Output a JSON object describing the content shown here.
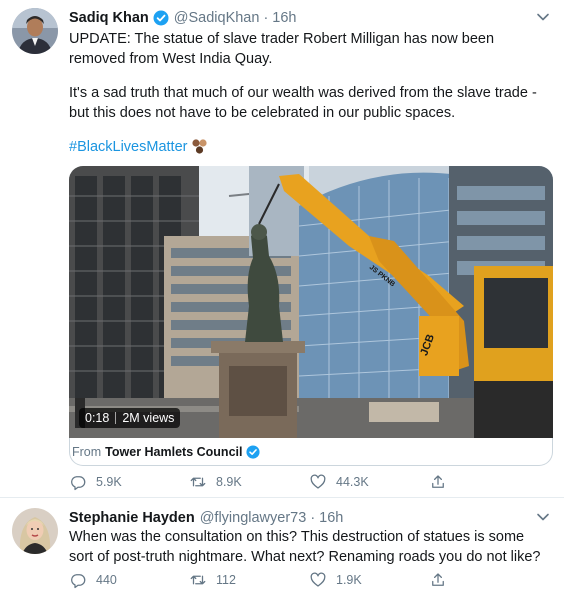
{
  "tweets": [
    {
      "author_name": "Sadiq Khan",
      "handle": "@SadiqKhan",
      "separator": "·",
      "time": "16h",
      "text_line_1": "UPDATE: The statue of slave trader Robert Milligan has now been removed from West India Quay.",
      "text_line_2": "It's a sad truth that much of our wealth was derived from the slave trade - but this does not have to be celebrated in our public spaces.",
      "hashtag": "#BlackLivesMatter",
      "media": {
        "duration": "0:18",
        "views": "2M views",
        "machine_label": "JCB",
        "machine_label_2": "JS PKNB"
      },
      "source_prefix": "From",
      "source_name": "Tower Hamlets Council",
      "replies": "5.9K",
      "retweets": "8.9K",
      "likes": "44.3K"
    },
    {
      "author_name": "Stephanie Hayden",
      "handle": "@flyinglawyer73",
      "separator": "·",
      "time": "16h",
      "text": "When was the consultation on this? This destruction of statues is some sort of post-truth nightmare. What next? Renaming roads you do not like?",
      "replies": "440",
      "retweets": "112",
      "likes": "1.9K"
    }
  ],
  "icons": {
    "verified": "verified-badge-icon",
    "caret": "chevron-down-icon",
    "reply": "reply-icon",
    "retweet": "retweet-icon",
    "like": "heart-icon",
    "share": "share-icon"
  },
  "colors": {
    "link": "#1b95e0",
    "secondary_text": "#657786",
    "verified": "#1da1f2"
  }
}
